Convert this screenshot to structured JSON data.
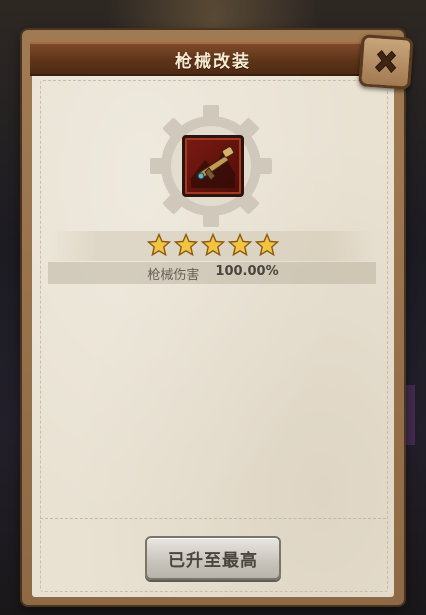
{
  "dialog": {
    "title": "枪械改装",
    "close_icon": "close-x-icon"
  },
  "item": {
    "icon": "firearm-icon",
    "frame_color": "#7a1a12"
  },
  "stars": {
    "filled": 5,
    "total": 5,
    "color": "#f2c443"
  },
  "stat": {
    "label": "枪械伤害",
    "value": "100.00%"
  },
  "action": {
    "label": "已升至最高"
  }
}
